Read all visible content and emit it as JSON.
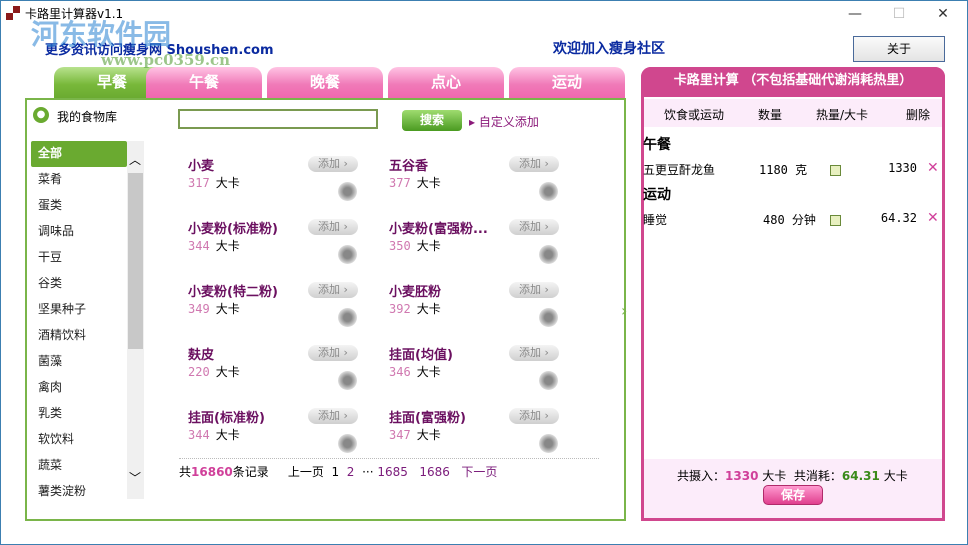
{
  "window": {
    "title": "卡路里计算器v1.1",
    "minimize": "—",
    "maximize": "☐",
    "close": "✕"
  },
  "watermark": {
    "text": "河东软件园",
    "url": "www.pc0359.cn"
  },
  "header": {
    "link": "更多资讯访问瘦身网 Shoushen.com",
    "welcome": "欢迎加入瘦身社区",
    "about": "关于"
  },
  "tabs": [
    {
      "label": "早餐"
    },
    {
      "label": "午餐"
    },
    {
      "label": "晚餐"
    },
    {
      "label": "点心"
    },
    {
      "label": "运动"
    }
  ],
  "library": {
    "title": "我的食物库",
    "categories": [
      "全部",
      "菜肴",
      "蛋类",
      "调味品",
      "干豆",
      "谷类",
      "坚果种子",
      "酒精饮料",
      "菌藻",
      "禽肉",
      "乳类",
      "软饮料",
      "蔬菜",
      "薯类淀粉"
    ]
  },
  "search": {
    "value": "",
    "button": "搜索",
    "custom_add": "自定义添加"
  },
  "foods": [
    {
      "name": "小麦",
      "cal": "317",
      "unit": "大卡"
    },
    {
      "name": "五谷香",
      "cal": "377",
      "unit": "大卡"
    },
    {
      "name": "小麦粉(标准粉)",
      "cal": "344",
      "unit": "大卡"
    },
    {
      "name": "小麦粉(富强粉...",
      "cal": "350",
      "unit": "大卡"
    },
    {
      "name": "小麦粉(特二粉)",
      "cal": "349",
      "unit": "大卡"
    },
    {
      "name": "小麦胚粉",
      "cal": "392",
      "unit": "大卡"
    },
    {
      "name": "麸皮",
      "cal": "220",
      "unit": "大卡"
    },
    {
      "name": "挂面(均值)",
      "cal": "346",
      "unit": "大卡"
    },
    {
      "name": "挂面(标准粉)",
      "cal": "344",
      "unit": "大卡"
    },
    {
      "name": "挂面(富强粉)",
      "cal": "347",
      "unit": "大卡"
    }
  ],
  "add_label": "添加 ›",
  "pager": {
    "prefix": "共",
    "count": "16860",
    "suffix": "条记录",
    "prev": "上一页",
    "p1": "1",
    "p2": "2",
    "ellipsis": "···",
    "p3": "1685",
    "p4": "1686",
    "next": "下一页"
  },
  "calc": {
    "title": "卡路里计算 （不包括基础代谢消耗热里）",
    "cols": [
      "饮食或运动",
      "数量",
      "热量/大卡",
      "删除"
    ],
    "sections": [
      {
        "name": "午餐",
        "rows": [
          {
            "item": "五更豆酐龙鱼",
            "qty": "1180 克",
            "cal": "1330"
          }
        ]
      },
      {
        "name": "运动",
        "rows": [
          {
            "item": "睡觉",
            "qty": "480 分钟",
            "cal": "64.32"
          }
        ]
      }
    ],
    "intake_label": "共摄入：",
    "intake": "1330",
    "burn_label": "共消耗：",
    "burn": "64.31",
    "unit": "大卡",
    "save": "保存"
  }
}
